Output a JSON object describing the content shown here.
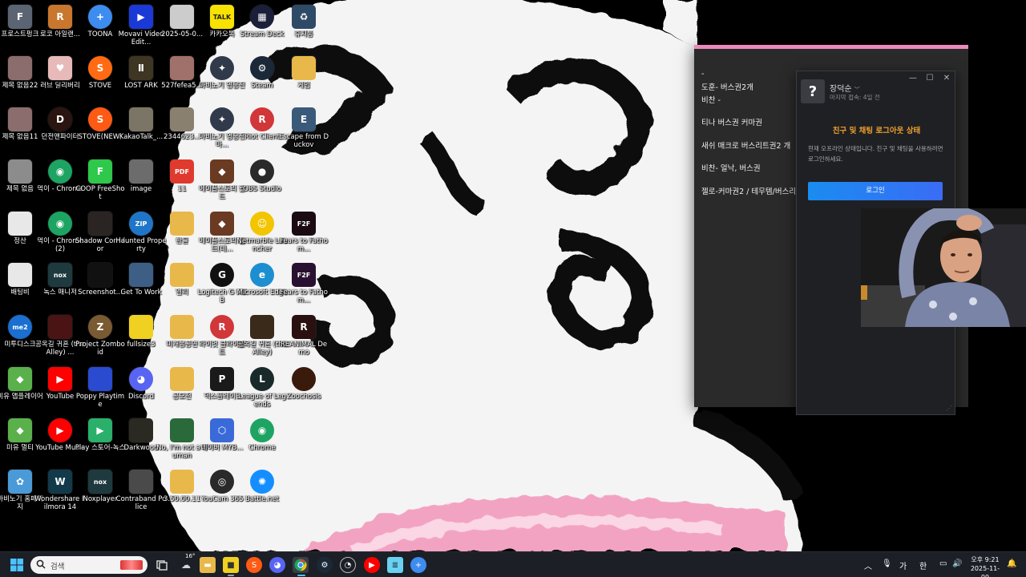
{
  "desktop": {
    "icons": [
      {
        "label": "프로스트펑크",
        "col": 0,
        "row": 0,
        "color": "#5b6472",
        "glyph": "F",
        "round": false
      },
      {
        "label": "로코 아일랜...",
        "col": 1,
        "row": 0,
        "color": "#c9762e",
        "glyph": "R",
        "round": false
      },
      {
        "label": "TOONA",
        "col": 2,
        "row": 0,
        "color": "#3d8cf0",
        "glyph": "+",
        "round": true
      },
      {
        "label": "Movavi Video Edit...",
        "col": 3,
        "row": 0,
        "color": "#1b39d6",
        "glyph": "▶",
        "round": false
      },
      {
        "label": "2025-05-0...",
        "col": 4,
        "row": 0,
        "color": "#cccccc",
        "glyph": "",
        "round": false
      },
      {
        "label": "카카오톡",
        "col": 5,
        "row": 0,
        "color": "#f7e200",
        "glyph": "TALK",
        "round": false
      },
      {
        "label": "Stream Deck",
        "col": 6,
        "row": 0,
        "color": "#1c1f3a",
        "glyph": "▦",
        "round": true
      },
      {
        "label": "휴지통",
        "col": 7,
        "row": 0,
        "color": "#2e4a66",
        "glyph": "♻",
        "round": false
      },
      {
        "label": "제목 없음22",
        "col": 0,
        "row": 1,
        "color": "#8c6d6d",
        "glyph": "",
        "round": false
      },
      {
        "label": "러브 딜리버리",
        "col": 1,
        "row": 1,
        "color": "#e7b9b9",
        "glyph": "♥",
        "round": false
      },
      {
        "label": "STOVE",
        "col": 2,
        "row": 1,
        "color": "#ff6a13",
        "glyph": "S",
        "round": true
      },
      {
        "label": "LOST ARK",
        "col": 3,
        "row": 1,
        "color": "#3e3523",
        "glyph": "Ⅱ",
        "round": false
      },
      {
        "label": "527fefea5...",
        "col": 4,
        "row": 1,
        "color": "#a0706a",
        "glyph": "",
        "round": false
      },
      {
        "label": "마비노기 영웅전",
        "col": 5,
        "row": 1,
        "color": "#303a4a",
        "glyph": "✦",
        "round": true
      },
      {
        "label": "Steam",
        "col": 6,
        "row": 1,
        "color": "#1b2838",
        "glyph": "⚙",
        "round": true
      },
      {
        "label": "게임",
        "col": 7,
        "row": 1,
        "color": "#e8b84a",
        "glyph": "",
        "round": false
      },
      {
        "label": "제목 없음11",
        "col": 0,
        "row": 2,
        "color": "#8c6d6d",
        "glyph": "",
        "round": false
      },
      {
        "label": "던전앤파이터",
        "col": 1,
        "row": 2,
        "color": "#2a1510",
        "glyph": "D",
        "round": true
      },
      {
        "label": "STOVE(NEW)",
        "col": 2,
        "row": 2,
        "color": "#ff5a13",
        "glyph": "S",
        "round": true
      },
      {
        "label": "KakaoTalk_...",
        "col": 3,
        "row": 2,
        "color": "#7a7565",
        "glyph": "",
        "round": false
      },
      {
        "label": "2344623...",
        "col": 4,
        "row": 2,
        "color": "#8a8070",
        "glyph": "",
        "round": false
      },
      {
        "label": "마비노기 영웅전 마...",
        "col": 5,
        "row": 2,
        "color": "#303a4a",
        "glyph": "✦",
        "round": true
      },
      {
        "label": "Riot Client",
        "col": 6,
        "row": 2,
        "color": "#d13639",
        "glyph": "R",
        "round": true
      },
      {
        "label": "Escape from Duckov",
        "col": 7,
        "row": 2,
        "color": "#3a5a7a",
        "glyph": "E",
        "round": false
      },
      {
        "label": "제목 없음",
        "col": 0,
        "row": 3,
        "color": "#8c8c8c",
        "glyph": "",
        "round": false
      },
      {
        "label": "먹이 - Chrome",
        "col": 1,
        "row": 3,
        "color": "#1da462",
        "glyph": "◉",
        "round": true
      },
      {
        "label": "COOP FreeShot",
        "col": 2,
        "row": 3,
        "color": "#2ec84a",
        "glyph": "F",
        "round": false
      },
      {
        "label": "image",
        "col": 3,
        "row": 3,
        "color": "#6c6c6c",
        "glyph": "",
        "round": false
      },
      {
        "label": "11",
        "col": 4,
        "row": 3,
        "color": "#e03a2f",
        "glyph": "PDF",
        "round": false
      },
      {
        "label": "메이플스토리 월드",
        "col": 5,
        "row": 3,
        "color": "#6a3a22",
        "glyph": "◆",
        "round": false
      },
      {
        "label": "OBS Studio",
        "col": 6,
        "row": 3,
        "color": "#2a2a2a",
        "glyph": "●",
        "round": true
      },
      {
        "label": "정산",
        "col": 0,
        "row": 4,
        "color": "#e8e8e8",
        "glyph": "",
        "round": false
      },
      {
        "label": "먹이 - Chrome (2)",
        "col": 1,
        "row": 4,
        "color": "#1da462",
        "glyph": "◉",
        "round": true
      },
      {
        "label": "Shadow Corridor",
        "col": 2,
        "row": 4,
        "color": "#2a2522",
        "glyph": "",
        "round": false
      },
      {
        "label": "Haunted Property",
        "col": 3,
        "row": 4,
        "color": "#1f76c8",
        "glyph": "ZIP",
        "round": true
      },
      {
        "label": "한글",
        "col": 4,
        "row": 4,
        "color": "#e8b84a",
        "glyph": "",
        "round": false
      },
      {
        "label": "메이플스토리 월드(테...",
        "col": 5,
        "row": 4,
        "color": "#6a3a22",
        "glyph": "◆",
        "round": false
      },
      {
        "label": "Netmarble Launcher",
        "col": 6,
        "row": 4,
        "color": "#f3c400",
        "glyph": "☺",
        "round": true
      },
      {
        "label": "Fears to Fathom...",
        "col": 7,
        "row": 4,
        "color": "#1a0a12",
        "glyph": "F2F",
        "round": false
      },
      {
        "label": "배팅비",
        "col": 0,
        "row": 5,
        "color": "#e8e8e8",
        "glyph": "",
        "round": false
      },
      {
        "label": "녹스 매니저",
        "col": 1,
        "row": 5,
        "color": "#1e3a3f",
        "glyph": "nox",
        "round": false
      },
      {
        "label": "Screenshot...",
        "col": 2,
        "row": 5,
        "color": "#111111",
        "glyph": "",
        "round": false
      },
      {
        "label": "Get To Work",
        "col": 3,
        "row": 5,
        "color": "#3d5f86",
        "glyph": "",
        "round": false
      },
      {
        "label": "엘리",
        "col": 4,
        "row": 5,
        "color": "#e8b84a",
        "glyph": "",
        "round": false
      },
      {
        "label": "Logitech G HUB",
        "col": 5,
        "row": 5,
        "color": "#111111",
        "glyph": "G",
        "round": true
      },
      {
        "label": "Microsoft Edge",
        "col": 6,
        "row": 5,
        "color": "#1d8fd0",
        "glyph": "e",
        "round": true
      },
      {
        "label": "Fears to Fathom...",
        "col": 7,
        "row": 5,
        "color": "#2a1030",
        "glyph": "F2F",
        "round": false
      },
      {
        "label": "미투디스크",
        "col": 0,
        "row": 6,
        "color": "#1a6fd0",
        "glyph": "me2",
        "round": true
      },
      {
        "label": "공옥길 귀혼 (the Alley) ...",
        "col": 1,
        "row": 6,
        "color": "#4a1414",
        "glyph": "",
        "round": false
      },
      {
        "label": "Project Zomboid",
        "col": 2,
        "row": 6,
        "color": "#7a5a32",
        "glyph": "Z",
        "round": true
      },
      {
        "label": "fullsize3",
        "col": 3,
        "row": 6,
        "color": "#f0d020",
        "glyph": "",
        "round": false
      },
      {
        "label": "미개봉공연",
        "col": 4,
        "row": 6,
        "color": "#e8b84a",
        "glyph": "",
        "round": false
      },
      {
        "label": "라이엇 클라이언트",
        "col": 5,
        "row": 6,
        "color": "#d13639",
        "glyph": "R",
        "round": true
      },
      {
        "label": "공옥길 귀혼 (the Alley)",
        "col": 6,
        "row": 6,
        "color": "#3a2a1a",
        "glyph": "",
        "round": false
      },
      {
        "label": "REANIMAL Demo",
        "col": 7,
        "row": 6,
        "color": "#2a1010",
        "glyph": "R",
        "round": false
      },
      {
        "label": "미유 앱플레이어",
        "col": 0,
        "row": 7,
        "color": "#5ab04a",
        "glyph": "◆",
        "round": false
      },
      {
        "label": "YouTube",
        "col": 1,
        "row": 7,
        "color": "#ff0000",
        "glyph": "▶",
        "round": false
      },
      {
        "label": "Poppy Playtime",
        "col": 2,
        "row": 7,
        "color": "#2a4ad0",
        "glyph": "",
        "round": false
      },
      {
        "label": "Discord",
        "col": 3,
        "row": 7,
        "color": "#5865f2",
        "glyph": "◕",
        "round": true
      },
      {
        "label": "공모전",
        "col": 4,
        "row": 7,
        "color": "#e8b84a",
        "glyph": "",
        "round": false
      },
      {
        "label": "덱스플레이3",
        "col": 5,
        "row": 7,
        "color": "#1a1a1a",
        "glyph": "P",
        "round": false
      },
      {
        "label": "League of Legends",
        "col": 6,
        "row": 7,
        "color": "#1a2a2a",
        "glyph": "L",
        "round": true
      },
      {
        "label": "Zoochosis",
        "col": 7,
        "row": 7,
        "color": "#3a1a0a",
        "glyph": "",
        "round": true
      },
      {
        "label": "미유 멀티",
        "col": 0,
        "row": 8,
        "color": "#5ab04a",
        "glyph": "◆",
        "round": false
      },
      {
        "label": "YouTube Music",
        "col": 1,
        "row": 8,
        "color": "#ff0000",
        "glyph": "▶",
        "round": true
      },
      {
        "label": "Play 스토어-녹스",
        "col": 2,
        "row": 8,
        "color": "#2ab06a",
        "glyph": "▶",
        "round": false
      },
      {
        "label": "Darkwood",
        "col": 3,
        "row": 8,
        "color": "#2a2a22",
        "glyph": "",
        "round": false
      },
      {
        "label": "No, I'm not a Human",
        "col": 4,
        "row": 8,
        "color": "#2a6a3a",
        "glyph": "",
        "round": false
      },
      {
        "label": "네이버 MYB...",
        "col": 5,
        "row": 8,
        "color": "#3a6ad8",
        "glyph": "⬡",
        "round": false
      },
      {
        "label": "Chrome",
        "col": 6,
        "row": 8,
        "color": "#1da462",
        "glyph": "◉",
        "round": true
      },
      {
        "label": "마비노기 홈페이지",
        "col": 0,
        "row": 9,
        "color": "#4a9ad8",
        "glyph": "✿",
        "round": false
      },
      {
        "label": "Wondershare Filmora 14",
        "col": 1,
        "row": 9,
        "color": "#123a4a",
        "glyph": "W",
        "round": false
      },
      {
        "label": "Noxplayer",
        "col": 2,
        "row": 9,
        "color": "#1e3a3f",
        "glyph": "nox",
        "round": false
      },
      {
        "label": "Contraband Police",
        "col": 3,
        "row": 9,
        "color": "#4a4a4a",
        "glyph": "",
        "round": false
      },
      {
        "label": "3.50.00.11",
        "col": 4,
        "row": 9,
        "color": "#e8b84a",
        "glyph": "",
        "round": false
      },
      {
        "label": "YouCam 365",
        "col": 5,
        "row": 9,
        "color": "#2a2a2a",
        "glyph": "◎",
        "round": true
      },
      {
        "label": "Battle.net",
        "col": 6,
        "row": 9,
        "color": "#148eff",
        "glyph": "✺",
        "round": true
      }
    ]
  },
  "notes": {
    "lines": [
      "-",
      "도훈- 버스권2개",
      "비찬 -",
      "티나 버스권 커마권",
      "새쉬 매크로 버스리트권2 개",
      "비찬- 얼낙, 버스권",
      "젤로-커마권2 / 테무템/버스리"
    ]
  },
  "panel": {
    "avatar_glyph": "?",
    "username": "장덕순",
    "last_seen": "마지막 접속: 4일 전",
    "status_title": "친구 및 채팅 로그아웃 상태",
    "status_desc": "현재 오프라인 상태입니다. 친구 및 채팅을 사용하려면 로그인하세요.",
    "login_label": "로그인",
    "minimize": "—",
    "maximize": "☐",
    "close": "✕",
    "accent": "#f0a030",
    "button_color": "#1a8cf0"
  },
  "taskbar": {
    "search_placeholder": "검색",
    "weather_temp": "16°",
    "ime_mode": "가",
    "ime_lang": "한",
    "time": "오후 9:21",
    "date": "2025-11-09"
  }
}
